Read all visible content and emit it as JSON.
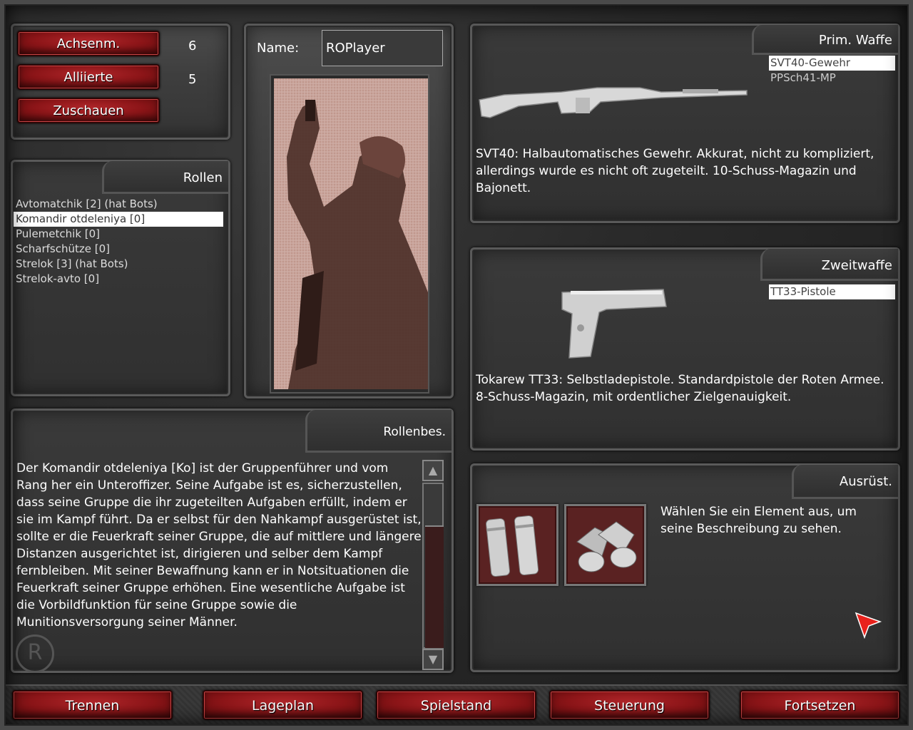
{
  "teams": [
    {
      "label": "Achsenm.",
      "count": "6"
    },
    {
      "label": "Alliierte",
      "count": "5"
    },
    {
      "label": "Zuschauen",
      "count": ""
    }
  ],
  "name": {
    "label": "Name:",
    "value": "ROPlayer"
  },
  "roles": {
    "header": "Rollen",
    "items": [
      "Avtomatchik [2] (hat Bots)",
      "Komandir otdeleniya [0]",
      "Pulemetchik [0]",
      "Scharfschütze [0]",
      "Strelok [3] (hat Bots)",
      "Strelok-avto [0]"
    ],
    "selected_index": 1
  },
  "role_desc": {
    "header": "Rollenbes.",
    "text": "Der Komandir otdeleniya [Ko] ist der Gruppenführer und vom Rang her ein Unteroffizer. Seine Aufgabe ist es, sicherzustellen, dass seine Gruppe die ihr zugeteilten Aufgaben erfüllt, indem er sie im Kampf führt. Da er selbst für den Nahkampf ausgerüstet ist, sollte er die Feuerkraft seiner Gruppe, die auf mittlere und längere Distanzen ausgerichtet ist, dirigieren und selber dem Kampf fernbleiben. Mit seiner Bewaffnung kann er in Notsituationen die Feuerkraft seiner Gruppe erhöhen. Eine wesentliche Aufgabe ist die Vorbildfunktion für seine Gruppe sowie die Munitionsversorgung seiner Männer."
  },
  "primary": {
    "header": "Prim. Waffe",
    "options": [
      "SVT40-Gewehr",
      "PPSch41-MP"
    ],
    "selected_index": 0,
    "desc": "SVT40: Halbautomatisches Gewehr. Akkurat, nicht zu kompliziert, allerdings wurde es nicht oft zugeteilt. 10-Schuss-Magazin und Bajonett."
  },
  "secondary": {
    "header": "Zweitwaffe",
    "options": [
      "TT33-Pistole"
    ],
    "selected_index": 0,
    "desc": "Tokarew TT33: Selbstladepistole. Standardpistole der Roten Armee. 8-Schuss-Magazin, mit ordentlicher Zielgenauigkeit."
  },
  "equipment": {
    "header": "Ausrüst.",
    "items": [
      {
        "icon": "grenades-icon"
      },
      {
        "icon": "binoculars-icon"
      }
    ],
    "desc": "Wählen Sie ein Element aus, um seine Beschreibung zu sehen."
  },
  "bottom": {
    "disconnect": "Trennen",
    "map": "Lageplan",
    "score": "Spielstand",
    "controls": "Steuerung",
    "continue": "Fortsetzen"
  },
  "colors": {
    "accent_red": "#8c1518",
    "panel": "#3e3e3e",
    "selection": "#ffffff"
  }
}
